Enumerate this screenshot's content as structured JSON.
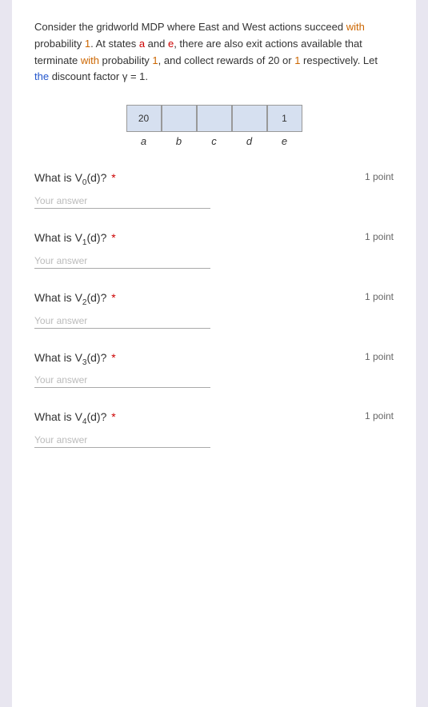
{
  "intro": {
    "text_part1": "Consider the gridworld MDP where East and West actions succeed ",
    "highlight_with": "with",
    "text_part2": " probability ",
    "highlight_1a": "1",
    "text_part3": ". At states ",
    "highlight_a": "a",
    "text_part4": " and ",
    "highlight_e": "e",
    "text_part5": ", there are also exit actions available that terminate ",
    "highlight_with2": "with",
    "text_part6": " probability ",
    "highlight_1b": "1",
    "text_part7": ", and collect rewards of 20 or ",
    "highlight_1c": "1",
    "text_part8": " respectively. Let ",
    "highlight_the": "the",
    "text_part9": " discount factor γ = 1.",
    "full_text": "Consider the gridworld MDP where East and West actions succeed with probability 1. At states a and e, there are also exit actions available that terminate with probability 1, and collect rewards of 20 or 1 respectively. Let the discount factor γ = 1."
  },
  "grid": {
    "cells": [
      {
        "value": "20",
        "id": "cell-a"
      },
      {
        "value": "",
        "id": "cell-b"
      },
      {
        "value": "",
        "id": "cell-c"
      },
      {
        "value": "",
        "id": "cell-d"
      },
      {
        "value": "1",
        "id": "cell-e"
      }
    ],
    "labels": [
      "a",
      "b",
      "c",
      "d",
      "e"
    ]
  },
  "questions": [
    {
      "id": "q0",
      "label": "What is V",
      "subscript": "0",
      "suffix": "(d)?",
      "required": "*",
      "points": "1 point",
      "placeholder": "Your answer"
    },
    {
      "id": "q1",
      "label": "What is V",
      "subscript": "1",
      "suffix": "(d)?",
      "required": "*",
      "points": "1 point",
      "placeholder": "Your answer"
    },
    {
      "id": "q2",
      "label": "What is V",
      "subscript": "2",
      "suffix": "(d)?",
      "required": "*",
      "points": "1 point",
      "placeholder": "Your answer"
    },
    {
      "id": "q3",
      "label": "What is V",
      "subscript": "3",
      "suffix": "(d)?",
      "required": "*",
      "points": "1 point",
      "placeholder": "Your answer"
    },
    {
      "id": "q4",
      "label": "What is V",
      "subscript": "4",
      "suffix": "(d)?",
      "required": "*",
      "points": "1 point",
      "placeholder": "Your answer"
    }
  ]
}
